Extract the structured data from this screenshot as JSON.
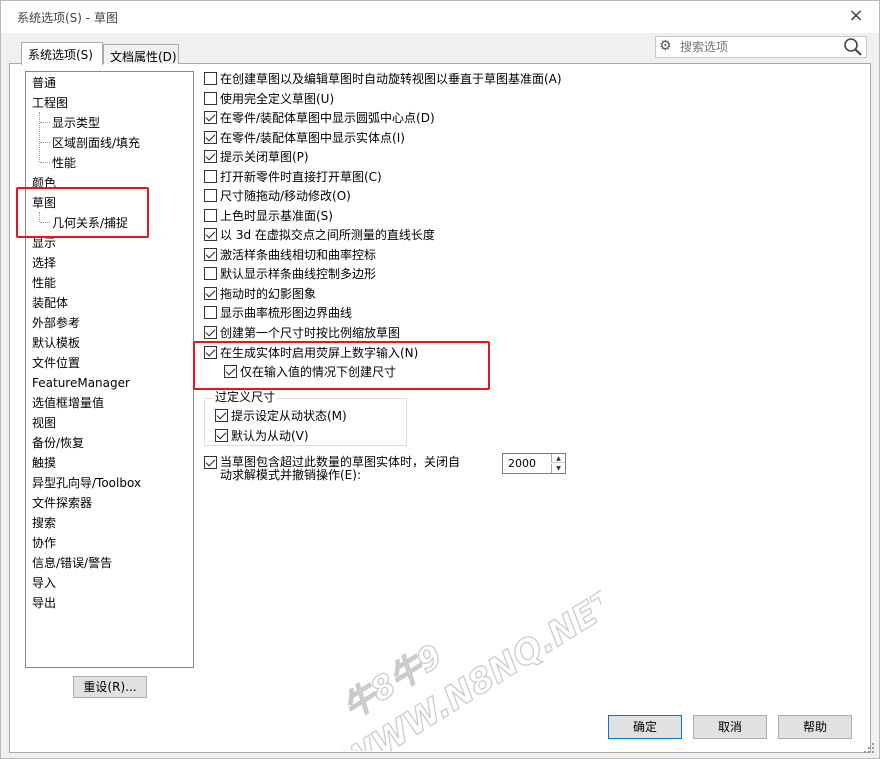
{
  "window": {
    "title": "系统选项(S) - 草图",
    "close_glyph": "×"
  },
  "tabs": [
    {
      "label": "系统选项(S)",
      "active": true
    },
    {
      "label": "文档属性(D)",
      "active": false
    }
  ],
  "search": {
    "placeholder": "搜索选项",
    "icon": "search-icon",
    "gear_icon": "gear-icon"
  },
  "tree": {
    "items": [
      {
        "label": "普通",
        "level": 0
      },
      {
        "label": "工程图",
        "level": 0
      },
      {
        "label": "显示类型",
        "level": 1
      },
      {
        "label": "区域剖面线/填充",
        "level": 1
      },
      {
        "label": "性能",
        "level": 1
      },
      {
        "label": "颜色",
        "level": 0
      },
      {
        "label": "草图",
        "level": 0
      },
      {
        "label": "几何关系/捕捉",
        "level": 1
      },
      {
        "label": "显示",
        "level": 0
      },
      {
        "label": "选择",
        "level": 0
      },
      {
        "label": "性能",
        "level": 0
      },
      {
        "label": "装配体",
        "level": 0
      },
      {
        "label": "外部参考",
        "level": 0
      },
      {
        "label": "默认模板",
        "level": 0
      },
      {
        "label": "文件位置",
        "level": 0
      },
      {
        "label": "FeatureManager",
        "level": 0
      },
      {
        "label": "选值框增量值",
        "level": 0
      },
      {
        "label": "视图",
        "level": 0
      },
      {
        "label": "备份/恢复",
        "level": 0
      },
      {
        "label": "触摸",
        "level": 0
      },
      {
        "label": "异型孔向导/Toolbox",
        "level": 0
      },
      {
        "label": "文件探索器",
        "level": 0
      },
      {
        "label": "搜索",
        "level": 0
      },
      {
        "label": "协作",
        "level": 0
      },
      {
        "label": "信息/错误/警告",
        "level": 0
      },
      {
        "label": "导入",
        "level": 0
      },
      {
        "label": "导出",
        "level": 0
      }
    ]
  },
  "reset_label": "重设(R)...",
  "options": [
    {
      "label": "在创建草图以及编辑草图时自动旋转视图以垂直于草图基准面(A)",
      "checked": false
    },
    {
      "label": "使用完全定义草图(U)",
      "checked": false
    },
    {
      "label": "在零件/装配体草图中显示圆弧中心点(D)",
      "checked": true
    },
    {
      "label": "在零件/装配体草图中显示实体点(I)",
      "checked": true
    },
    {
      "label": "提示关闭草图(P)",
      "checked": true
    },
    {
      "label": "打开新零件时直接打开草图(C)",
      "checked": false
    },
    {
      "label": "尺寸随拖动/移动修改(O)",
      "checked": false
    },
    {
      "label": "上色时显示基准面(S)",
      "checked": false
    },
    {
      "label": "以 3d 在虚拟交点之间所测量的直线长度",
      "checked": true
    },
    {
      "label": "激活样条曲线相切和曲率控标",
      "checked": true
    },
    {
      "label": "默认显示样条曲线控制多边形",
      "checked": false
    },
    {
      "label": "拖动时的幻影图象",
      "checked": true
    },
    {
      "label": "显示曲率梳形图边界曲线",
      "checked": false
    },
    {
      "label": "创建第一个尺寸时按比例缩放草图",
      "checked": true
    },
    {
      "label": "在生成实体时启用荧屏上数字输入(N)",
      "checked": true
    },
    {
      "label": "仅在输入值的情况下创建尺寸",
      "checked": true
    }
  ],
  "over_defined": {
    "title": "过定义尺寸",
    "options": [
      {
        "label": "提示设定从动状态(M)",
        "checked": true
      },
      {
        "label": "默认为从动(V)",
        "checked": true
      }
    ]
  },
  "auto_solve": {
    "line1": "当草图包含超过此数量的草图实体时，关闭自",
    "line2": "动求解模式并撤销操作(E):",
    "checked": true,
    "value": "2000"
  },
  "buttons": {
    "ok": "确定",
    "cancel": "取消",
    "help": "帮助"
  },
  "watermark": {
    "line1": "牛8牛9",
    "line2": "WWW.N8NQ.NET"
  },
  "colors": {
    "highlight_red": "#e8161c",
    "accent_blue": "#0078d7"
  }
}
